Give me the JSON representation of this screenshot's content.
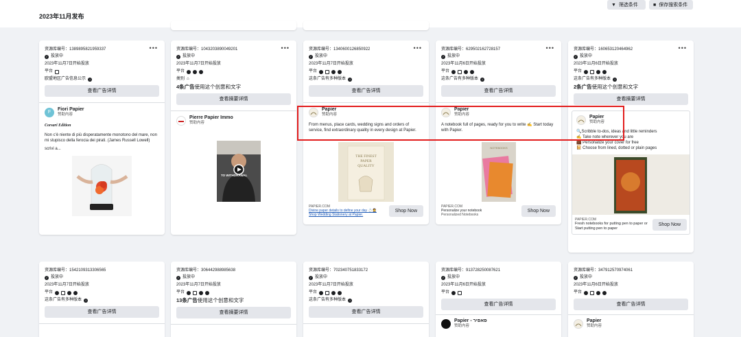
{
  "header": {
    "date_heading": "2023年11月发布",
    "filter_label": "筛选条件",
    "save_label": "保存搜索条件"
  },
  "common": {
    "status": "投放中",
    "platform_label": "平台",
    "detail_button": "查看广告详情",
    "summary_button": "查看摘要详情",
    "multi_version_note": "这条广告有多种版本",
    "eu_note": "欧盟地区广告信息公示",
    "sponsored": "赞助内容",
    "shop_now": "Shop Now",
    "more": "•••"
  },
  "row1": [
    {
      "lib_id": "资源库编号：1389895821959337",
      "date": "2023年11月7日开始投放",
      "advertiser": "Fiori Papier",
      "italic_line": "Corsari Edition",
      "body": "Non c'è niente di più disperatamente monotono del mare, non mi stupisco della ferocia dei pirati. (James Russell Lowell)",
      "more_text": "scrivi a..."
    },
    {
      "lib_id": "资源库编号：1043203890049201",
      "date": "2023年11月7日开始投放",
      "category": "类别",
      "multi_count": "4条广告",
      "multi_rest": "使用这个创意和文字",
      "advertiser": "Pierre Papier Immo",
      "video_caption": "TO WITHDRAWAL"
    },
    {
      "lib_id": "资源库编号：1340600126850922",
      "date": "2023年11月7日开始投放",
      "advertiser": "Papier",
      "body": "From menus, place cards, wedding signs and orders of service, find extraordinary quality in every design at Papier.",
      "image_text": "THE FINEST PAPER QUALITY",
      "domain": "PAPIER.COM",
      "link_title": "Divine paper details to define your day 💍🤵",
      "link_sub": "Shop Wedding Stationery at Papier."
    },
    {
      "lib_id": "资源库编号：629502162728157",
      "date": "2023年11月6日开始投放",
      "advertiser": "Papier",
      "body": "A notebook full of pages, ready for you to write ✍️ Start today with Papier.",
      "image_text": "NOTEBOOKS",
      "domain": "PAPIER.COM",
      "link_title": "Personalize your notebook",
      "link_sub": "Personalized Notebooks"
    },
    {
      "lib_id": "资源库编号：160653120464962",
      "date": "2023年11月6日开始投放",
      "multi_count": "2条广告",
      "multi_rest": "使用这个创意和文字",
      "advertiser": "Papier",
      "bullets": [
        "🔍Scribble to-dos, ideas and little reminders",
        "✍️ Take note wherever you are",
        "💼 Personalize your cover for free",
        "📔 Choose from lined, dotted or plain pages"
      ],
      "domain": "PAPIER.COM",
      "link_title": "Fresh notebooks for putting pen to paper or Start putting pen to paper"
    }
  ],
  "row2": [
    {
      "lib_id": "资源库编号：1542109313306565",
      "date": "2023年11月7日开始投放",
      "advertiser": "Papier"
    },
    {
      "lib_id": "资源库编号：306442988985638",
      "date": "2023年11月7日开始投放",
      "multi_count": "13条广告",
      "multi_rest": "使用这个创意和文字",
      "advertiser": "Papier"
    },
    {
      "lib_id": "资源库编号：702340751833172",
      "date": "2023年11月7日开始投放",
      "advertiser": "Papier"
    },
    {
      "lib_id": "资源库编号：913728250087621",
      "date": "2023年11月6日开始投放",
      "advertiser": "Papier - פאפיר"
    },
    {
      "lib_id": "资源库编号：347912570974061",
      "date": "2023年11月6日开始投放",
      "advertiser": "Papier"
    }
  ],
  "colors": {
    "highlight": "#e21b1b",
    "button_bg": "#e4e6eb",
    "page_bg": "#f0f2f5"
  }
}
